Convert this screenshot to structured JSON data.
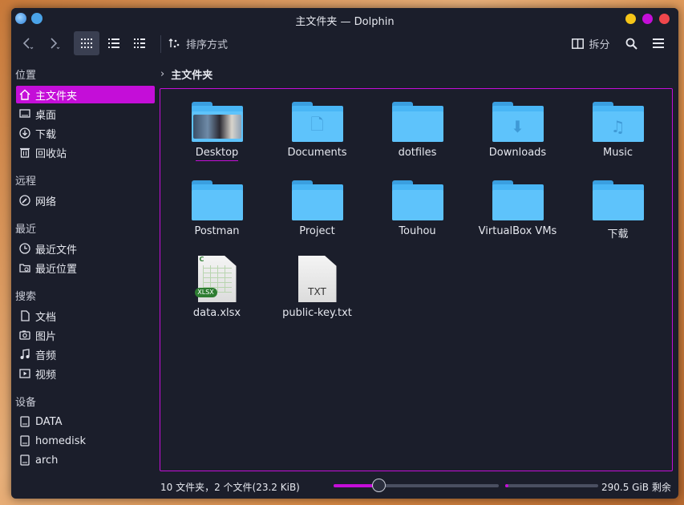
{
  "window": {
    "title": "主文件夹 — Dolphin"
  },
  "toolbar": {
    "sort_label": "排序方式",
    "split_label": "拆分"
  },
  "sidebar": {
    "sections": [
      {
        "header": "位置",
        "items": [
          {
            "label": "主文件夹",
            "icon": "home-icon",
            "active": true
          },
          {
            "label": "桌面",
            "icon": "desktop-icon"
          },
          {
            "label": "下载",
            "icon": "download-icon"
          },
          {
            "label": "回收站",
            "icon": "trash-icon"
          }
        ]
      },
      {
        "header": "远程",
        "items": [
          {
            "label": "网络",
            "icon": "network-icon"
          }
        ]
      },
      {
        "header": "最近",
        "items": [
          {
            "label": "最近文件",
            "icon": "recent-files-icon"
          },
          {
            "label": "最近位置",
            "icon": "recent-locations-icon"
          }
        ]
      },
      {
        "header": "搜索",
        "items": [
          {
            "label": "文档",
            "icon": "document-icon"
          },
          {
            "label": "图片",
            "icon": "image-icon"
          },
          {
            "label": "音频",
            "icon": "audio-icon"
          },
          {
            "label": "视频",
            "icon": "video-icon"
          }
        ]
      },
      {
        "header": "设备",
        "items": [
          {
            "label": "DATA",
            "icon": "drive-icon"
          },
          {
            "label": "homedisk",
            "icon": "drive-icon"
          },
          {
            "label": "arch",
            "icon": "drive-icon"
          }
        ]
      }
    ]
  },
  "breadcrumb": {
    "current": "主文件夹"
  },
  "files": [
    {
      "name": "Desktop",
      "type": "desktop-folder",
      "selected": true
    },
    {
      "name": "Documents",
      "type": "folder",
      "glyph": "🗋"
    },
    {
      "name": "dotfiles",
      "type": "folder"
    },
    {
      "name": "Downloads",
      "type": "folder",
      "glyph": "⬇"
    },
    {
      "name": "Music",
      "type": "folder",
      "glyph": "♫"
    },
    {
      "name": "Postman",
      "type": "folder"
    },
    {
      "name": "Project",
      "type": "folder"
    },
    {
      "name": "Touhou",
      "type": "folder"
    },
    {
      "name": "VirtualBox VMs",
      "type": "folder"
    },
    {
      "name": "下载",
      "type": "folder"
    },
    {
      "name": "data.xlsx",
      "type": "xlsx"
    },
    {
      "name": "public-key.txt",
      "type": "txt",
      "badge": "TXT"
    }
  ],
  "status": {
    "summary": "10 文件夹，2 个文件(23.2 KiB)",
    "zoom_fraction": 0.27,
    "disk_used_fraction": 0.03,
    "free_space": "290.5 GiB 剩余"
  },
  "colors": {
    "accent": "#c40ed8",
    "folder": "#5ec3fb",
    "background": "#1b1e2b"
  }
}
